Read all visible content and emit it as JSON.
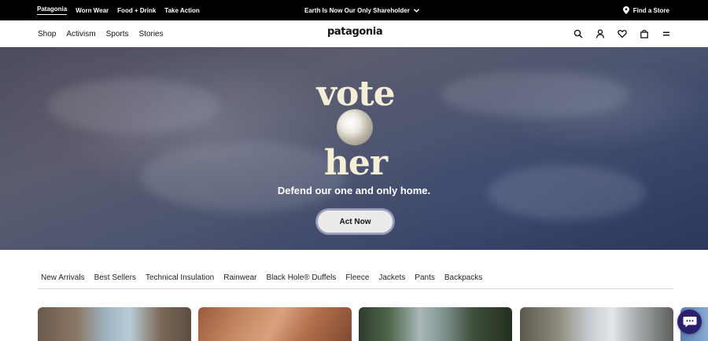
{
  "topbar": {
    "brands": [
      "Patagonia",
      "Worn Wear",
      "Food + Drink",
      "Take Action"
    ],
    "promo": "Earth Is Now Our Only Shareholder",
    "find_store": "Find a Store"
  },
  "nav": {
    "links": [
      "Shop",
      "Activism",
      "Sports",
      "Stories"
    ],
    "logo": "patagonia",
    "icons": [
      "search-icon",
      "account-icon",
      "wishlist-heart-icon",
      "cart-bag-icon",
      "menu-icon"
    ]
  },
  "hero": {
    "wordmark_top": "vote",
    "wordmark_bottom": "her",
    "tagline": "Defend our one and only home.",
    "cta": "Act Now"
  },
  "categories": [
    "New Arrivals",
    "Best Sellers",
    "Technical Insulation",
    "Rainwear",
    "Black Hole® Duffels",
    "Fleece",
    "Jackets",
    "Pants",
    "Backpacks"
  ],
  "colors": {
    "topbar_bg": "#000000",
    "wordmark": "#f4efd6",
    "cta_border": "#9aa0c6",
    "chat_bg": "#2c1f6e"
  }
}
